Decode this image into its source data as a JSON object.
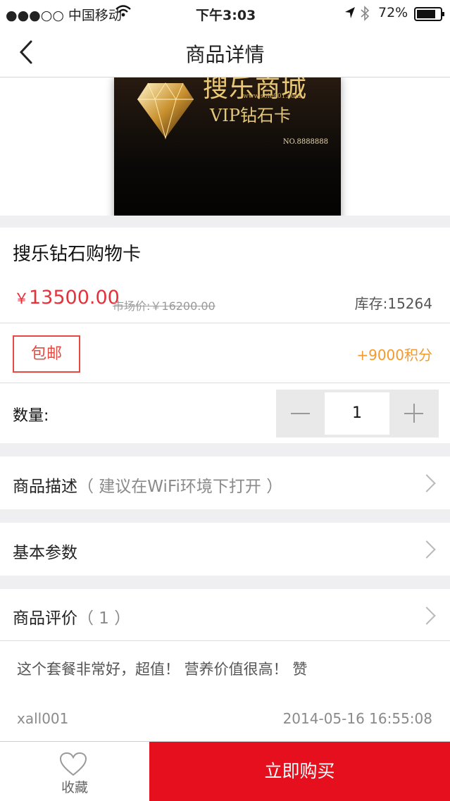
{
  "status_bar": {
    "carrier": "●●●○○ 中国移动",
    "time": "下午3:03",
    "battery": "72%"
  },
  "nav": {
    "title": "商品详情"
  },
  "card_image": {
    "title": "搜乐商城",
    "url": "www.sole001.com",
    "vip": "VIP钻石卡",
    "number": "NO.8888888"
  },
  "product": {
    "name": "搜乐钻石购物卡",
    "currency": "￥",
    "price": "13500.00",
    "market_price": "市场价:￥16200.00",
    "stock": "库存:15264",
    "free_shipping": "包邮",
    "points": "+9000积分"
  },
  "quantity": {
    "label": "数量:",
    "value": "1"
  },
  "rows": {
    "description_label": "商品描述",
    "description_hint": "（ 建议在WiFi环境下打开 ）",
    "params_label": "基本参数",
    "reviews_label": "商品评价",
    "reviews_count": "（ 1 ）"
  },
  "review": {
    "text": "这个套餐非常好，超值！ 营养价值很高！ 赞",
    "user": "xall001",
    "date": "2014-05-16 16:55:08"
  },
  "bottom_bar": {
    "favorite_label": "收藏",
    "buy_label": "立即购买"
  },
  "colors": {
    "accent_red": "#e50f1d",
    "price_red": "#e6313a",
    "points_orange": "#f39a2e"
  }
}
